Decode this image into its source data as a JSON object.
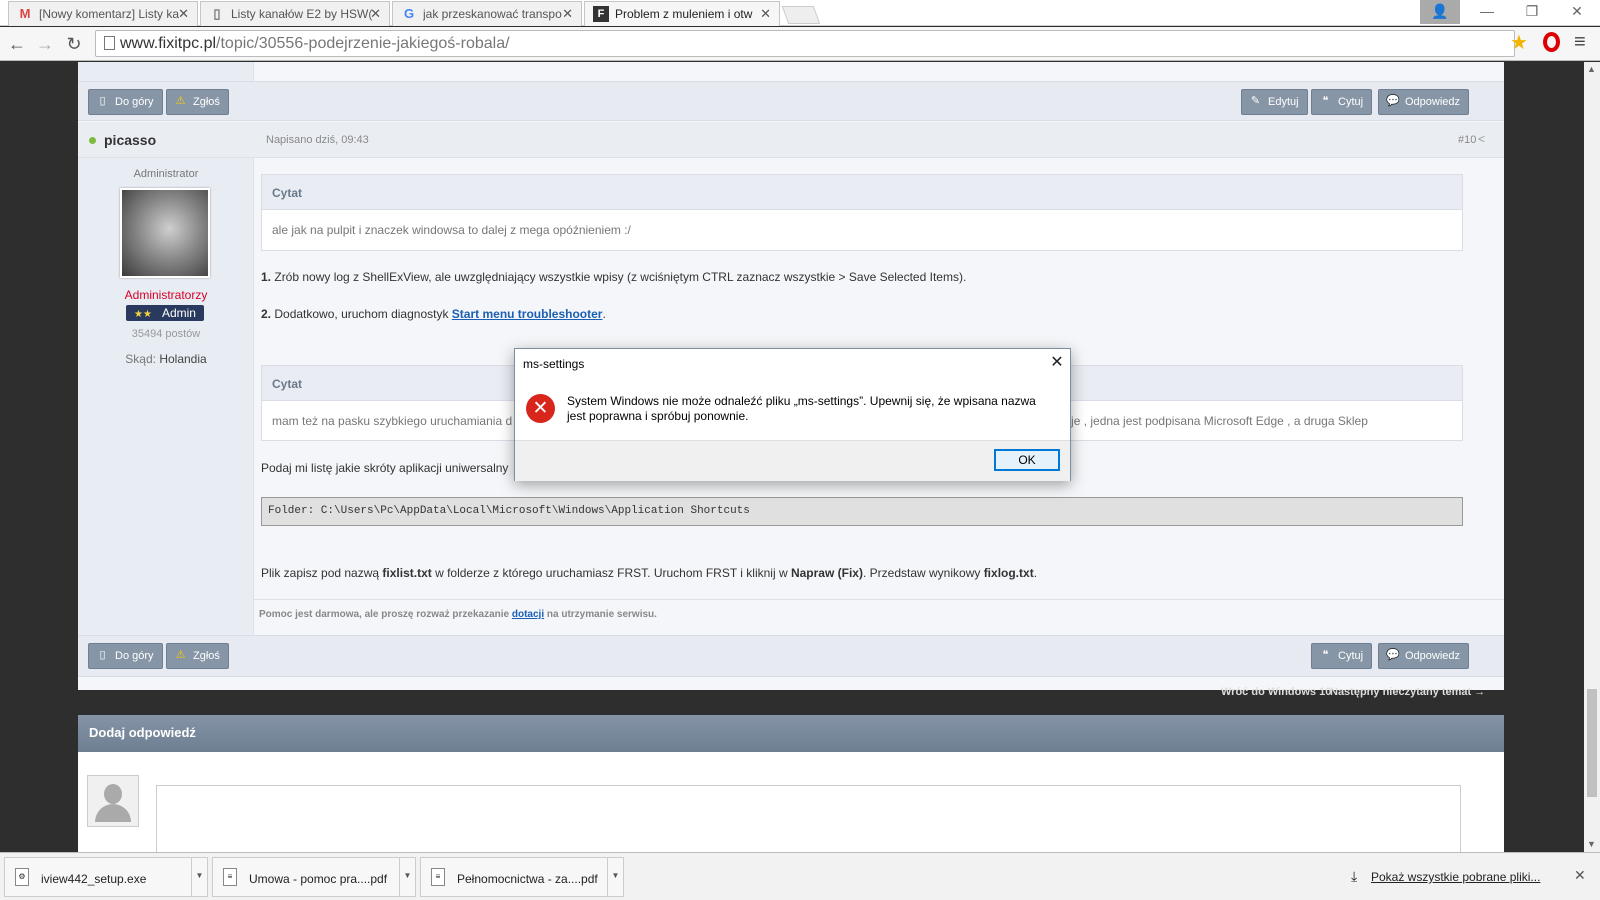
{
  "browser": {
    "tabs": [
      {
        "icon": "M",
        "title": "[Nowy komentarz] Listy ka"
      },
      {
        "icon": "▯",
        "title": "Listy kanałów E2 by HSW("
      },
      {
        "icon": "G",
        "title": "jak przeskanować transpo"
      },
      {
        "icon": "F",
        "title": "Problem z muleniem i otw"
      }
    ],
    "url_host": "www.fixitpc.pl",
    "url_path": "/topic/30556-podejrzenie-jakiegoś-robala/",
    "window_buttons": {
      "user": "👤",
      "minimize": "—",
      "restore": "❐",
      "close": "✕"
    }
  },
  "post": {
    "top_buttons": {
      "to_top": "Do góry",
      "report": "Zgłoś",
      "edit": "Edytuj",
      "quote": "Cytuj",
      "reply": "Odpowiedz"
    },
    "author": "picasso",
    "written": "Napisano dziś, 09:43",
    "post_number": "#10",
    "user": {
      "role": "Administrator",
      "group": "Administratorzy",
      "rank_stars": "★★",
      "rank": "Admin",
      "post_count": "35494 postów",
      "from_label": "Skąd:",
      "from_value": "Holandia"
    },
    "quote1": {
      "header": "Cytat",
      "body": "ale jak na pulpit i znaczek windowsa to dalej z mega opóźnieniem :/"
    },
    "p1_num": "1.",
    "p1_text": "Zrób nowy log z ShellExView, ale uwzględniający wszystkie wpisy (z wciśniętym CTRL zaznacz wszystkie > Save Selected Items).",
    "p2_num": "2.",
    "p2_text": "Dodatkowo, uruchom diagnostyk",
    "p2_link": "Start menu troubleshooter",
    "p2_end": ".",
    "quote2": {
      "header": "Cytat",
      "body_left": "mam też na pasku szybkiego uruchamiania d",
      "body_right": "e dzieje , jedna jest podpisana Microsoft Edge , a druga Sklep"
    },
    "p3_text": "Podaj mi listę jakie skróty aplikacji uniwersalny",
    "code": "Folder: C:\\Users\\Pc\\AppData\\Local\\Microsoft\\Windows\\Application Shortcuts",
    "p4_a": "Plik zapisz pod nazwą ",
    "p4_b": "fixlist.txt",
    "p4_c": " w folderze z którego uruchamiasz FRST. Uruchom FRST i kliknij w ",
    "p4_d": "Napraw (Fix)",
    "p4_e": ". Przedstaw wynikowy ",
    "p4_f": "fixlog.txt",
    "p4_g": ".",
    "sig_a": "Pomoc jest darmowa, ale proszę rozważ przekazanie ",
    "sig_link": "dotacji",
    "sig_b": " na utrzymanie serwisu.",
    "bottom_buttons": {
      "to_top": "Do góry",
      "report": "Zgłoś",
      "quote": "Cytuj",
      "reply": "Odpowiedz"
    }
  },
  "nav": {
    "back": "Wróć do Windows 10",
    "next": "Następny nieczytany temat →"
  },
  "reply": {
    "title": "Dodaj odpowiedź"
  },
  "dialog": {
    "title": "ms-settings",
    "close": "✕",
    "error_icon": "✕",
    "message": "System Windows nie może odnaleźć pliku „ms-settings”. Upewnij się, że wpisana nazwa jest poprawna i spróbuj ponownie.",
    "ok": "OK"
  },
  "downloads": {
    "items": [
      {
        "name": "iview442_setup.exe"
      },
      {
        "name": "Umowa - pomoc pra....pdf"
      },
      {
        "name": "Pełnomocnictwa - za....pdf"
      }
    ],
    "show_all": "Pokaż wszystkie pobrane pliki...",
    "close": "✕"
  },
  "colors": {
    "accent": "#1a5fb4",
    "group": "#d8002a",
    "error": "#d8261c",
    "button": "#8796a6"
  }
}
